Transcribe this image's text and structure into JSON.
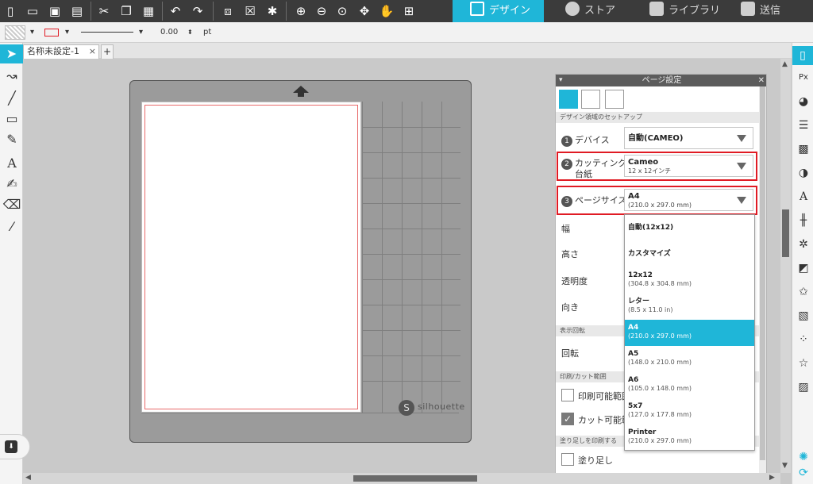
{
  "toolbar": {
    "icons": [
      "new-file",
      "open-folder",
      "save",
      "print",
      "cut",
      "copy",
      "paste",
      "undo",
      "redo",
      "group",
      "ungroup",
      "replicate",
      "zoom-in",
      "zoom-out",
      "zoom-fit",
      "pan-arrows",
      "hand",
      "crosshair"
    ]
  },
  "nav": {
    "design": "デザイン",
    "store": "ストア",
    "library": "ライブラリ",
    "send": "送信",
    "accent": "#1fb6d8"
  },
  "line": {
    "width": "0.00",
    "unit": "pt"
  },
  "document": {
    "tab_label": "名称未設定-1",
    "close": "×",
    "add": "+"
  },
  "mat": {
    "logo": "silhouette"
  },
  "panel": {
    "title": "ページ設定",
    "section_setup": "デザイン領域のセットアップ",
    "device_label": "デバイス",
    "device_value": "自動(CAMEO)",
    "mat_label_1": "カッティング用",
    "mat_label_2": "台紙",
    "mat_value": "Cameo",
    "mat_sub": "12 x 12インチ",
    "size_label": "ページサイズ",
    "size_value": "A4",
    "size_sub": "(210.0 x 297.0 mm)",
    "width_label": "幅",
    "height_label": "高さ",
    "opacity_label": "透明度",
    "orientation_label": "向き",
    "section_rotate": "表示回転",
    "rotate_label": "回転",
    "section_print": "印刷/カット範囲",
    "print_area": "印刷可能範囲",
    "cut_area": "カット可能範囲",
    "section_bleed": "塗り足しを印刷する",
    "bleed": "塗り足し",
    "num1": "1",
    "num2": "2",
    "num3": "3"
  },
  "page_size_options": [
    {
      "name": "自動(12x12)",
      "size": ""
    },
    {
      "name": "カスタマイズ",
      "size": ""
    },
    {
      "name": "12x12",
      "size": "(304.8 x 304.8 mm)"
    },
    {
      "name": "レター",
      "size": "(8.5 x 11.0 in)"
    },
    {
      "name": "A4",
      "size": "(210.0 x 297.0 mm)",
      "selected": true
    },
    {
      "name": "A5",
      "size": "(148.0 x 210.0 mm)"
    },
    {
      "name": "A6",
      "size": "(105.0 x 148.0 mm)"
    },
    {
      "name": "5x7",
      "size": "(127.0 x 177.8 mm)"
    },
    {
      "name": "Printer",
      "size": "(210.0 x 297.0 mm)"
    }
  ]
}
